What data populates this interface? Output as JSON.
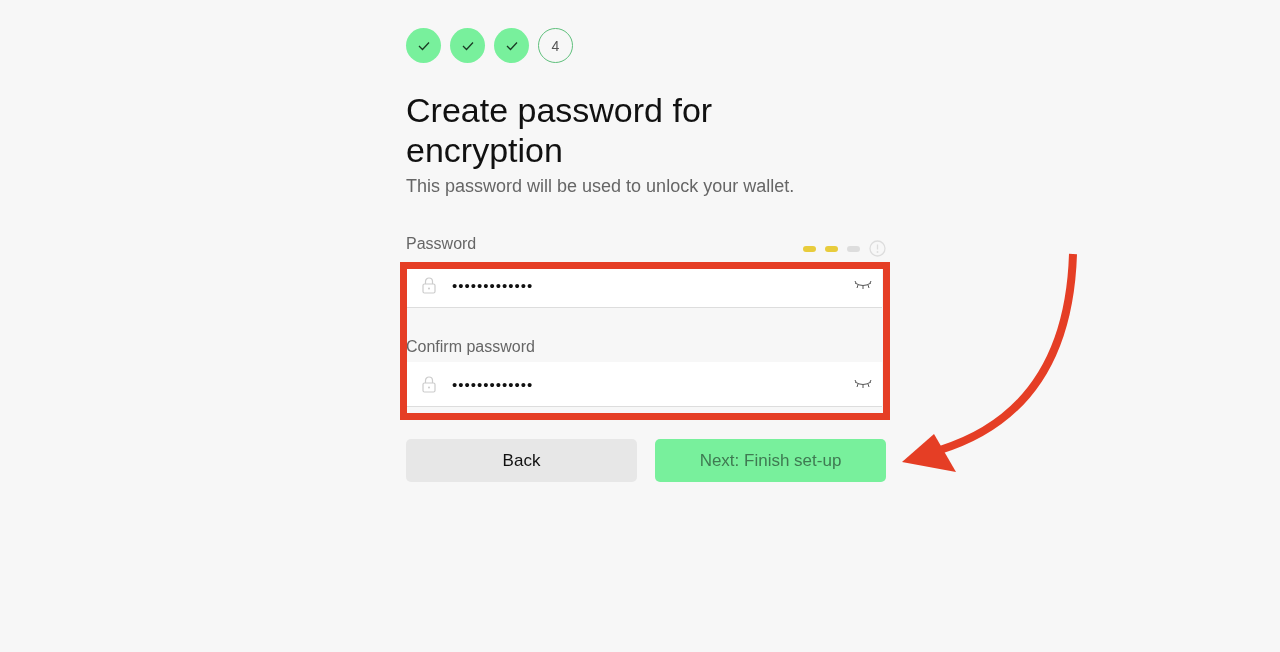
{
  "steps": [
    {
      "completed": true
    },
    {
      "completed": true
    },
    {
      "completed": true
    },
    {
      "completed": false,
      "label": "4"
    }
  ],
  "title": "Create password for encryption",
  "subtitle": "This password will be used to unlock your wallet.",
  "fields": [
    {
      "label": "Password",
      "value": "•••••••••••••",
      "strength": [
        {
          "on": true
        },
        {
          "on": true
        },
        {
          "on": false
        }
      ]
    },
    {
      "label": "Confirm password",
      "value": "•••••••••••••"
    }
  ],
  "buttons": [
    {
      "label": "Back",
      "kind": "secondary"
    },
    {
      "label": "Next: Finish set-up",
      "kind": "primary"
    }
  ]
}
